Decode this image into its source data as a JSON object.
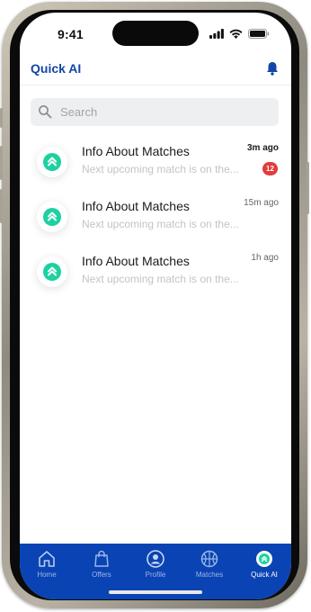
{
  "status_bar": {
    "time": "9:41"
  },
  "header": {
    "title": "Quick AI",
    "bell_icon": "bell-icon"
  },
  "search": {
    "placeholder": "Search",
    "value": ""
  },
  "colors": {
    "brand": "#1446a8",
    "tabbar": "#0a43b3",
    "accent_teal": "#1dd1a1",
    "badge": "#e23b3b"
  },
  "messages": [
    {
      "title": "Info About Matches",
      "preview": "Next upcoming match is on the...",
      "time": "3m ago",
      "unread": "12",
      "icon": "quick-ai-logo-icon"
    },
    {
      "title": "Info About Matches",
      "preview": "Next upcoming match is on the...",
      "time": "15m ago",
      "icon": "quick-ai-logo-icon"
    },
    {
      "title": "Info About Matches",
      "preview": "Next upcoming match is on the...",
      "time": "1h ago",
      "icon": "quick-ai-logo-icon"
    }
  ],
  "tabbar": {
    "tabs": [
      {
        "label": "Home",
        "icon": "home-icon"
      },
      {
        "label": "Offers",
        "icon": "shopping-bag-icon"
      },
      {
        "label": "Profile",
        "icon": "profile-icon"
      },
      {
        "label": "Matches",
        "icon": "basketball-icon"
      },
      {
        "label": "Quick AI",
        "icon": "quick-ai-icon",
        "active": true
      }
    ]
  }
}
